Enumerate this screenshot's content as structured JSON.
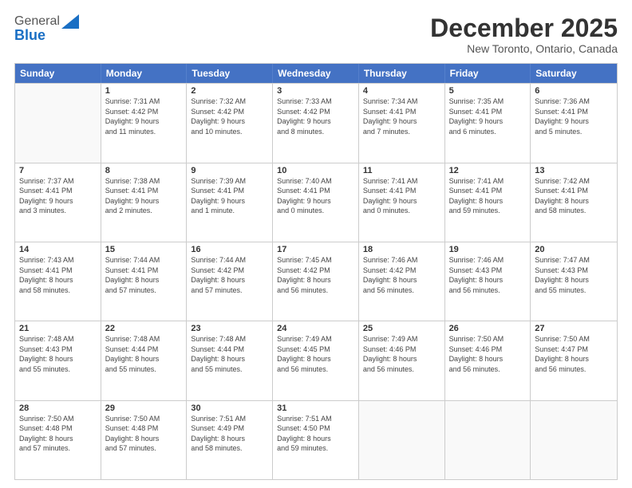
{
  "logo": {
    "general": "General",
    "blue": "Blue"
  },
  "header": {
    "month": "December 2025",
    "location": "New Toronto, Ontario, Canada"
  },
  "days_of_week": [
    "Sunday",
    "Monday",
    "Tuesday",
    "Wednesday",
    "Thursday",
    "Friday",
    "Saturday"
  ],
  "weeks": [
    [
      {
        "day": "",
        "info": ""
      },
      {
        "day": "1",
        "info": "Sunrise: 7:31 AM\nSunset: 4:42 PM\nDaylight: 9 hours\nand 11 minutes."
      },
      {
        "day": "2",
        "info": "Sunrise: 7:32 AM\nSunset: 4:42 PM\nDaylight: 9 hours\nand 10 minutes."
      },
      {
        "day": "3",
        "info": "Sunrise: 7:33 AM\nSunset: 4:42 PM\nDaylight: 9 hours\nand 8 minutes."
      },
      {
        "day": "4",
        "info": "Sunrise: 7:34 AM\nSunset: 4:41 PM\nDaylight: 9 hours\nand 7 minutes."
      },
      {
        "day": "5",
        "info": "Sunrise: 7:35 AM\nSunset: 4:41 PM\nDaylight: 9 hours\nand 6 minutes."
      },
      {
        "day": "6",
        "info": "Sunrise: 7:36 AM\nSunset: 4:41 PM\nDaylight: 9 hours\nand 5 minutes."
      }
    ],
    [
      {
        "day": "7",
        "info": "Sunrise: 7:37 AM\nSunset: 4:41 PM\nDaylight: 9 hours\nand 3 minutes."
      },
      {
        "day": "8",
        "info": "Sunrise: 7:38 AM\nSunset: 4:41 PM\nDaylight: 9 hours\nand 2 minutes."
      },
      {
        "day": "9",
        "info": "Sunrise: 7:39 AM\nSunset: 4:41 PM\nDaylight: 9 hours\nand 1 minute."
      },
      {
        "day": "10",
        "info": "Sunrise: 7:40 AM\nSunset: 4:41 PM\nDaylight: 9 hours\nand 0 minutes."
      },
      {
        "day": "11",
        "info": "Sunrise: 7:41 AM\nSunset: 4:41 PM\nDaylight: 9 hours\nand 0 minutes."
      },
      {
        "day": "12",
        "info": "Sunrise: 7:41 AM\nSunset: 4:41 PM\nDaylight: 8 hours\nand 59 minutes."
      },
      {
        "day": "13",
        "info": "Sunrise: 7:42 AM\nSunset: 4:41 PM\nDaylight: 8 hours\nand 58 minutes."
      }
    ],
    [
      {
        "day": "14",
        "info": "Sunrise: 7:43 AM\nSunset: 4:41 PM\nDaylight: 8 hours\nand 58 minutes."
      },
      {
        "day": "15",
        "info": "Sunrise: 7:44 AM\nSunset: 4:41 PM\nDaylight: 8 hours\nand 57 minutes."
      },
      {
        "day": "16",
        "info": "Sunrise: 7:44 AM\nSunset: 4:42 PM\nDaylight: 8 hours\nand 57 minutes."
      },
      {
        "day": "17",
        "info": "Sunrise: 7:45 AM\nSunset: 4:42 PM\nDaylight: 8 hours\nand 56 minutes."
      },
      {
        "day": "18",
        "info": "Sunrise: 7:46 AM\nSunset: 4:42 PM\nDaylight: 8 hours\nand 56 minutes."
      },
      {
        "day": "19",
        "info": "Sunrise: 7:46 AM\nSunset: 4:43 PM\nDaylight: 8 hours\nand 56 minutes."
      },
      {
        "day": "20",
        "info": "Sunrise: 7:47 AM\nSunset: 4:43 PM\nDaylight: 8 hours\nand 55 minutes."
      }
    ],
    [
      {
        "day": "21",
        "info": "Sunrise: 7:48 AM\nSunset: 4:43 PM\nDaylight: 8 hours\nand 55 minutes."
      },
      {
        "day": "22",
        "info": "Sunrise: 7:48 AM\nSunset: 4:44 PM\nDaylight: 8 hours\nand 55 minutes."
      },
      {
        "day": "23",
        "info": "Sunrise: 7:48 AM\nSunset: 4:44 PM\nDaylight: 8 hours\nand 55 minutes."
      },
      {
        "day": "24",
        "info": "Sunrise: 7:49 AM\nSunset: 4:45 PM\nDaylight: 8 hours\nand 56 minutes."
      },
      {
        "day": "25",
        "info": "Sunrise: 7:49 AM\nSunset: 4:46 PM\nDaylight: 8 hours\nand 56 minutes."
      },
      {
        "day": "26",
        "info": "Sunrise: 7:50 AM\nSunset: 4:46 PM\nDaylight: 8 hours\nand 56 minutes."
      },
      {
        "day": "27",
        "info": "Sunrise: 7:50 AM\nSunset: 4:47 PM\nDaylight: 8 hours\nand 56 minutes."
      }
    ],
    [
      {
        "day": "28",
        "info": "Sunrise: 7:50 AM\nSunset: 4:48 PM\nDaylight: 8 hours\nand 57 minutes."
      },
      {
        "day": "29",
        "info": "Sunrise: 7:50 AM\nSunset: 4:48 PM\nDaylight: 8 hours\nand 57 minutes."
      },
      {
        "day": "30",
        "info": "Sunrise: 7:51 AM\nSunset: 4:49 PM\nDaylight: 8 hours\nand 58 minutes."
      },
      {
        "day": "31",
        "info": "Sunrise: 7:51 AM\nSunset: 4:50 PM\nDaylight: 8 hours\nand 59 minutes."
      },
      {
        "day": "",
        "info": ""
      },
      {
        "day": "",
        "info": ""
      },
      {
        "day": "",
        "info": ""
      }
    ]
  ]
}
